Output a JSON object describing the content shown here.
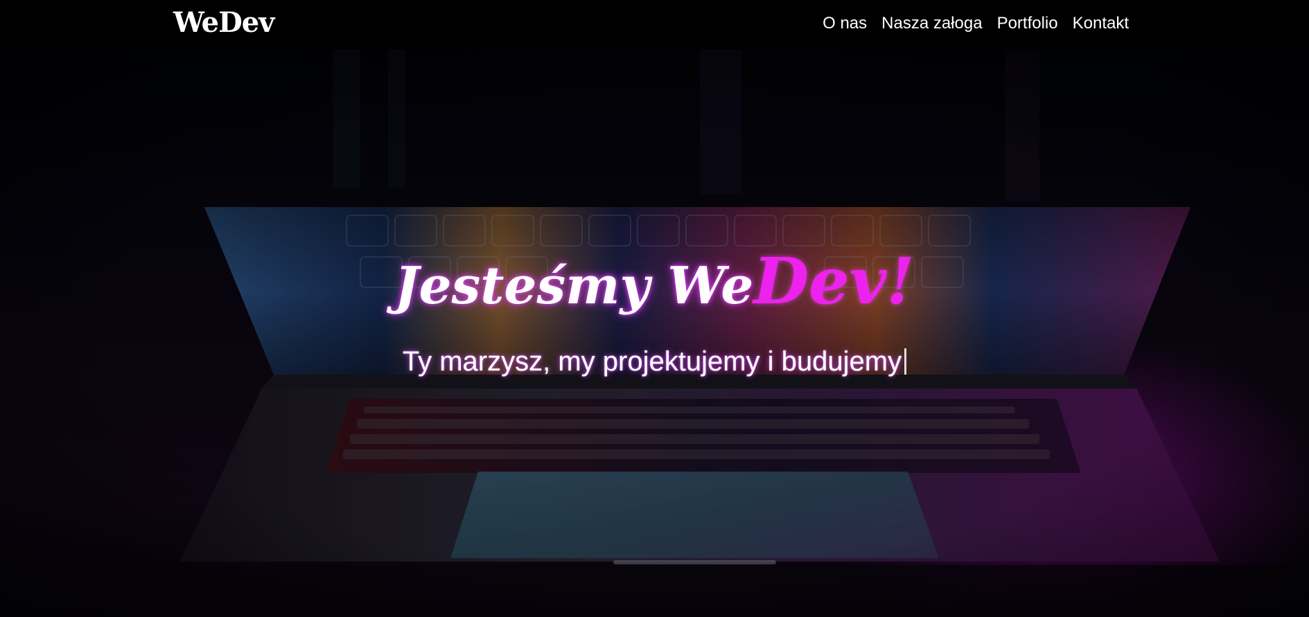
{
  "header": {
    "logo": "WeDev",
    "nav": [
      {
        "label": "O nas"
      },
      {
        "label": "Nasza załoga"
      },
      {
        "label": "Portfolio"
      },
      {
        "label": "Kontakt"
      }
    ]
  },
  "hero": {
    "title_main": "Jesteśmy We",
    "title_accent": "Dev!",
    "subtitle": "Ty marzysz, my projektujemy i budujemy"
  },
  "colors": {
    "accent": "#EE22EE",
    "navbar": "#000000",
    "text": "#FFFFFF"
  }
}
